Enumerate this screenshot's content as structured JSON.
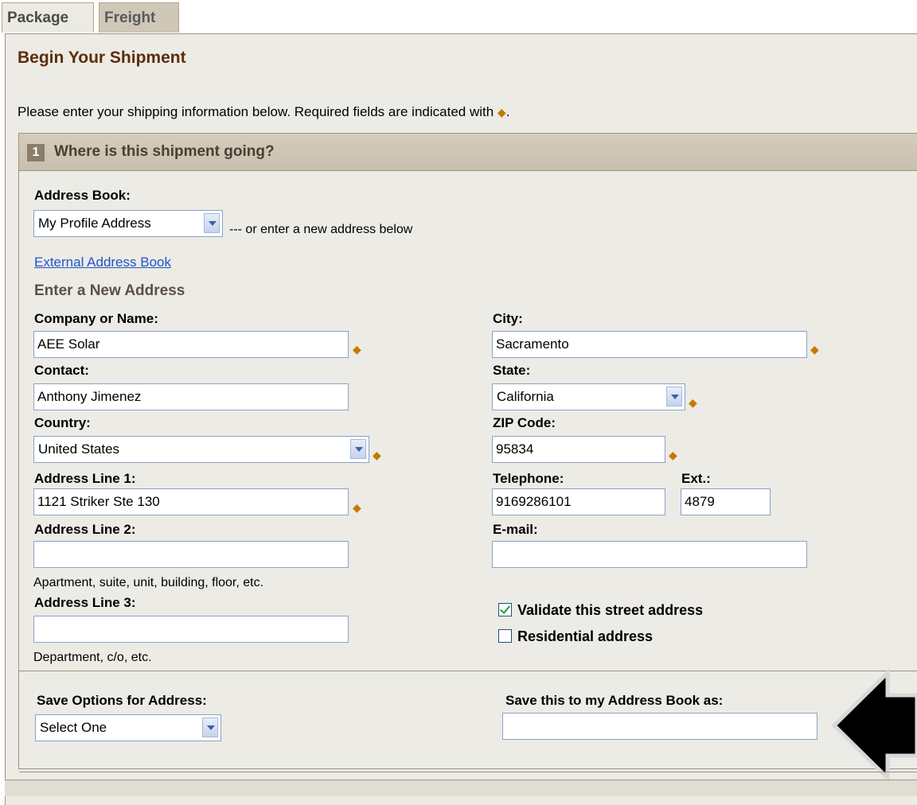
{
  "tabs": {
    "package": "Package",
    "freight": "Freight"
  },
  "page_title": "Begin Your Shipment",
  "intro": "Please enter your shipping information below. Required fields are indicated with",
  "required_symbol": "◆",
  "section": {
    "number": "1",
    "title": "Where is this shipment going?"
  },
  "address_book": {
    "label": "Address Book:",
    "selected": "My Profile Address",
    "hint": "--- or enter a new address below",
    "external_link": "External Address Book"
  },
  "new_address_heading": "Enter a New Address",
  "fields": {
    "company_label": "Company or Name:",
    "company_value": "AEE Solar",
    "contact_label": "Contact:",
    "contact_value": "Anthony Jimenez",
    "country_label": "Country:",
    "country_value": "United States",
    "address1_label": "Address Line 1:",
    "address1_value": "1121 Striker Ste 130",
    "address2_label": "Address Line 2:",
    "address2_value": "",
    "address2_hint": "Apartment, suite, unit, building, floor, etc.",
    "address3_label": "Address Line 3:",
    "address3_value": "",
    "address3_hint": "Department, c/o, etc.",
    "city_label": "City:",
    "city_value": "Sacramento",
    "state_label": "State:",
    "state_value": "California",
    "zip_label": "ZIP Code:",
    "zip_value": "95834",
    "phone_label": "Telephone:",
    "phone_value": "9169286101",
    "ext_label": "Ext.:",
    "ext_value": "4879",
    "email_label": "E-mail:",
    "email_value": ""
  },
  "checkboxes": {
    "validate_label": "Validate this street address",
    "validate_checked": true,
    "residential_label": "Residential address",
    "residential_checked": false
  },
  "save": {
    "options_label": "Save Options for Address:",
    "options_selected": "Select One",
    "book_as_label": "Save this to my Address Book as:",
    "book_as_value": ""
  },
  "colors": {
    "title": "#5c2d0a",
    "required": "#c47a00",
    "link": "#2255cc",
    "panel_bg": "#ecebe5"
  }
}
